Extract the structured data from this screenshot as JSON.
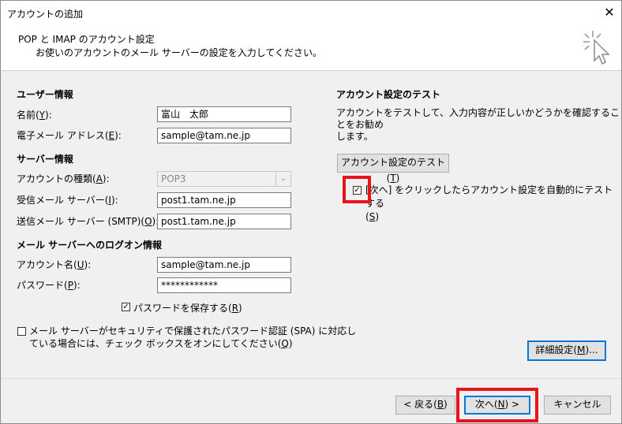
{
  "window": {
    "title": "アカウントの追加",
    "close_glyph": "✕"
  },
  "header": {
    "title": "POP と IMAP のアカウント設定",
    "subtitle": "お使いのアカウントのメール サーバーの設定を入力してください。",
    "icon": "wizard-cursor-icon"
  },
  "user_info": {
    "section_title": "ユーザー情報",
    "name_label_pre": "名前(",
    "name_key": "Y",
    "name_label_post": "):",
    "name_value": "富山　太郎",
    "email_label_pre": "電子メール アドレス(",
    "email_key": "E",
    "email_label_post": "):",
    "email_value": "sample@tam.ne.jp"
  },
  "server_info": {
    "section_title": "サーバー情報",
    "account_type_pre": "アカウントの種類(",
    "account_type_key": "A",
    "account_type_post": "):",
    "account_type_value": "POP3",
    "incoming_pre": "受信メール サーバー(",
    "incoming_key": "I",
    "incoming_post": "):",
    "incoming_value": "post1.tam.ne.jp",
    "outgoing_pre": "送信メール サーバー (SMTP)(",
    "outgoing_key": "O",
    "outgoing_post": "):",
    "outgoing_value": "post1.tam.ne.jp"
  },
  "logon_info": {
    "section_title": "メール サーバーへのログオン情報",
    "account_name_pre": "アカウント名(",
    "account_name_key": "U",
    "account_name_post": "):",
    "account_name_value": "sample@tam.ne.jp",
    "password_pre": "パスワード(",
    "password_key": "P",
    "password_post": "):",
    "password_value": "************",
    "remember_pre": "パスワードを保存する(",
    "remember_key": "R",
    "remember_post": ")",
    "remember_checked": true
  },
  "spa": {
    "line1": "メール サーバーがセキュリティで保護されたパスワード認証 (SPA) に対応し",
    "line2_pre": "ている場合には、チェック ボックスをオンにしてください(",
    "line2_key": "Q",
    "line2_post": ")",
    "checked": false
  },
  "test": {
    "section_title": "アカウント設定のテスト",
    "desc_line1": "アカウントをテストして、入力内容が正しいかどうかを確認することをお勧め",
    "desc_line2": "します。",
    "button_pre": "アカウント設定のテスト(",
    "button_key": "T",
    "button_post": ")",
    "auto_test_line1": "[次へ] をクリックしたらアカウント設定を自動的にテストする",
    "auto_test_line2_pre": "(",
    "auto_test_key": "S",
    "auto_test_line2_post": ")",
    "auto_test_checked": true
  },
  "buttons": {
    "advanced_pre": "詳細設定(",
    "advanced_key": "M",
    "advanced_post": ")...",
    "back_pre": "< 戻る(",
    "back_key": "B",
    "back_post": ")",
    "next_pre": "次へ(",
    "next_key": "N",
    "next_post": ") >",
    "cancel": "キャンセル"
  },
  "colors": {
    "highlight": "#e8141c",
    "panel": "#f0f0f0",
    "focus_border": "#0078d7"
  }
}
